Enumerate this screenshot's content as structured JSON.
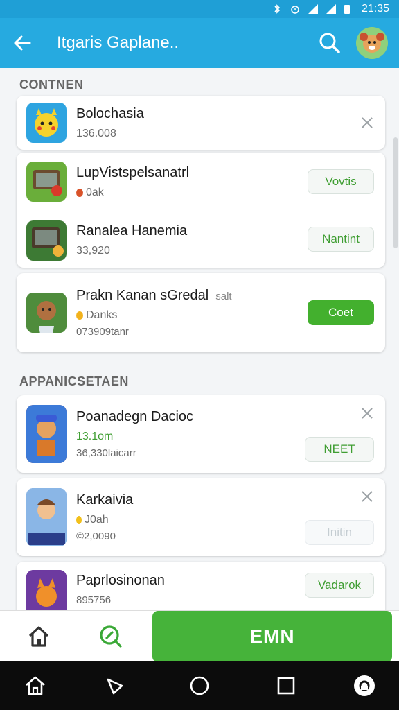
{
  "status_bar": {
    "time": "21:35"
  },
  "app_bar": {
    "title": "Itgaris Gaplane..",
    "back_icon": "arrow-left-icon",
    "search_icon": "search-icon",
    "avatar_icon": "avatar-icon"
  },
  "section1": {
    "title": "CONTNEN",
    "card1": {
      "name": "Bolochasia",
      "meta": "136.008"
    },
    "card2": [
      {
        "name": "LupVistspelsanatrl",
        "meta": "0ak",
        "button": "Vovtis"
      },
      {
        "name": "Ranalea Hanemia",
        "meta": "33,920",
        "button": "Nantint"
      }
    ],
    "card3": {
      "name": "Prakn Kanan sGredal",
      "tag": "salt",
      "meta": "Danks",
      "sub": "073909tanr",
      "button": "Coet"
    }
  },
  "section2": {
    "title": "APPANICSETAEN",
    "items": [
      {
        "name": "Poanadegn Dacioc",
        "meta": "13.1om",
        "sub": "36,330laicarr",
        "button": "NEET"
      },
      {
        "name": "Karkaivia",
        "meta": "J0ah",
        "sub": "©2,0090",
        "button": "Initin"
      },
      {
        "name": "Paprlosinonan",
        "sub": "895756",
        "button": "Vadarok"
      }
    ]
  },
  "bottom_nav": {
    "action_label": "EМN"
  },
  "colors": {
    "appbar": "#26aae0",
    "accent_green": "#43b02e"
  }
}
